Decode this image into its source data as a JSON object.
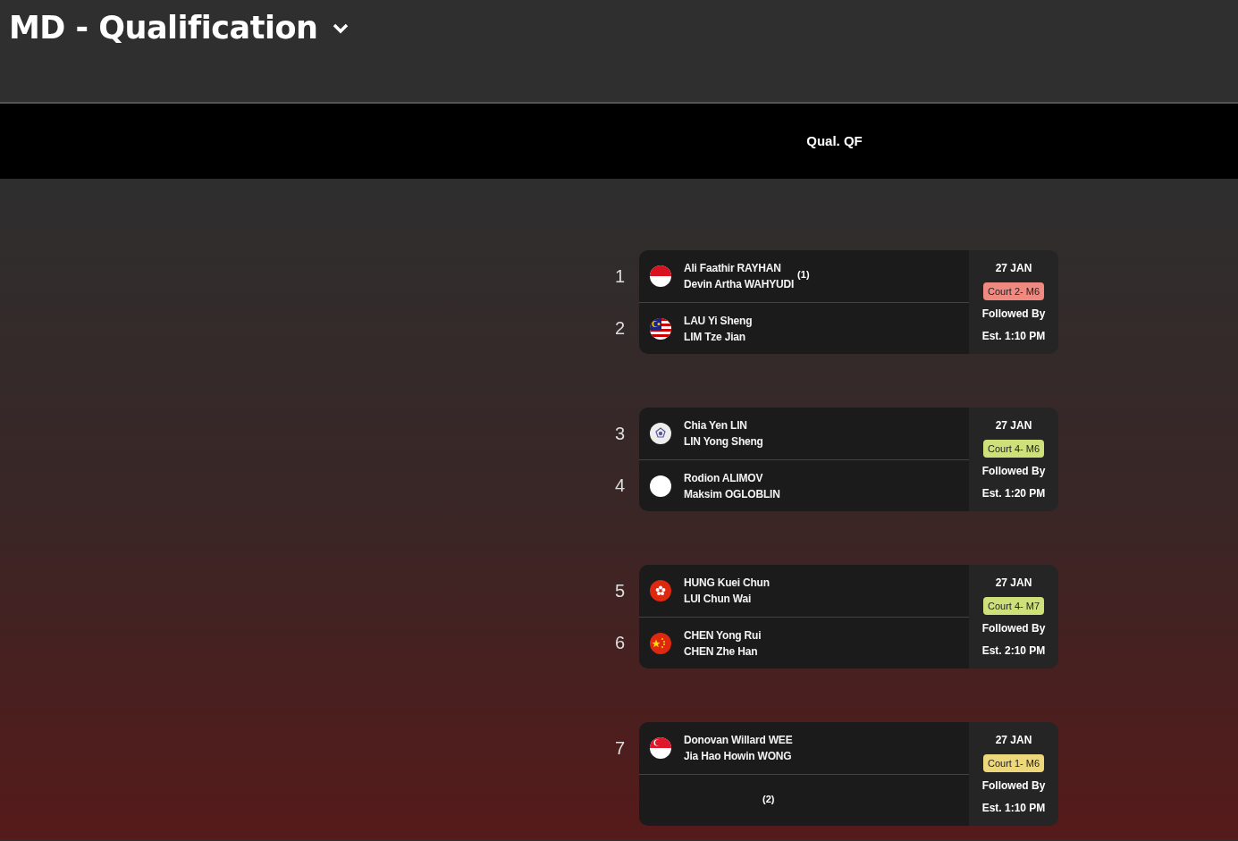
{
  "title": "MD - Qualification",
  "round_header": "Qual. QF",
  "matches": [
    {
      "date": "27 JAN",
      "court": {
        "label": "Court 2- M6",
        "color": "#f08a80"
      },
      "followed_label": "Followed By",
      "est": "Est. 1:10 PM",
      "players": [
        {
          "number": "1",
          "flag": {
            "kind": "indonesia"
          },
          "names": [
            "Ali Faathir RAYHAN",
            "Devin Artha WAHYUDI"
          ],
          "seed": "(1)"
        },
        {
          "number": "2",
          "flag": {
            "kind": "malaysia"
          },
          "names": [
            "LAU Yi Sheng",
            "LIM Tze Jian"
          ]
        }
      ]
    },
    {
      "date": "27 JAN",
      "court": {
        "label": "Court 4- M6",
        "color": "#cde07a"
      },
      "followed_label": "Followed By",
      "est": "Est. 1:20 PM",
      "players": [
        {
          "number": "3",
          "flag": {
            "kind": "emblem"
          },
          "names": [
            "Chia Yen LIN",
            "LIN Yong Sheng"
          ]
        },
        {
          "number": "4",
          "flag": {
            "kind": "blank"
          },
          "names": [
            "Rodion ALIMOV",
            "Maksim OGLOBLIN"
          ]
        }
      ]
    },
    {
      "date": "27 JAN",
      "court": {
        "label": "Court 4- M7",
        "color": "#cde07a"
      },
      "followed_label": "Followed By",
      "est": "Est. 2:10 PM",
      "players": [
        {
          "number": "5",
          "flag": {
            "kind": "flower"
          },
          "names": [
            "HUNG Kuei Chun",
            "LUI Chun Wai"
          ]
        },
        {
          "number": "6",
          "flag": {
            "kind": "stars"
          },
          "names": [
            "CHEN Yong Rui",
            "CHEN Zhe Han"
          ]
        }
      ]
    },
    {
      "date": "27 JAN",
      "court": {
        "label": "Court 1- M6",
        "color": "#ecd77a"
      },
      "followed_label": "Followed By",
      "est": "Est. 1:10 PM",
      "players": [
        {
          "number": "7",
          "flag": {
            "kind": "crescent"
          },
          "names": [
            "Donovan Willard WEE",
            "Jia Hao Howin WONG"
          ]
        },
        {
          "seed": "(2)"
        }
      ]
    }
  ]
}
